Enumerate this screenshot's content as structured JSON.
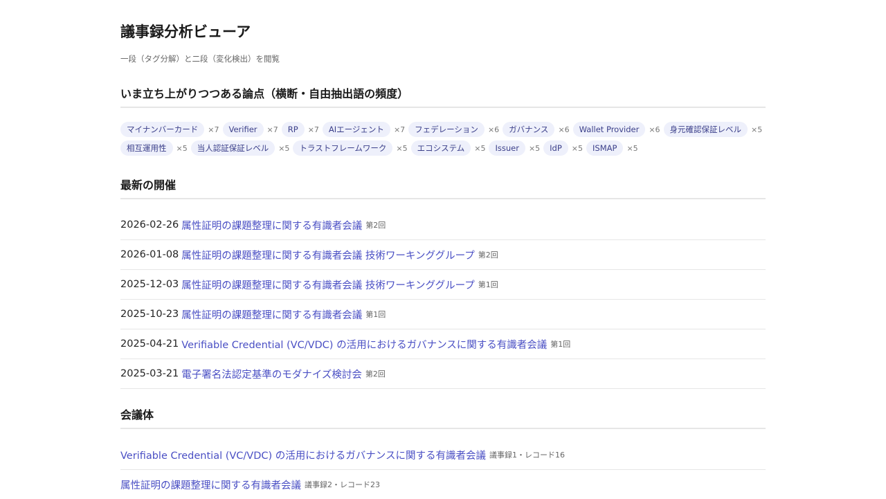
{
  "header": {
    "title": "議事録分析ビューア",
    "subtitle": "一段（タグ分解）と二段（変化検出）を閲覧"
  },
  "trending": {
    "title": "いま立ち上がりつつある論点（横断・自由抽出語の頻度）",
    "tags": [
      {
        "label": "マイナンバーカード",
        "count": "×7"
      },
      {
        "label": "Verifier",
        "count": "×7"
      },
      {
        "label": "RP",
        "count": "×7"
      },
      {
        "label": "AIエージェント",
        "count": "×7"
      },
      {
        "label": "フェデレーション",
        "count": "×6"
      },
      {
        "label": "ガバナンス",
        "count": "×6"
      },
      {
        "label": "Wallet Provider",
        "count": "×6"
      },
      {
        "label": "身元確認保証レベル",
        "count": "×5"
      },
      {
        "label": "相互運用性",
        "count": "×5"
      },
      {
        "label": "当人認証保証レベル",
        "count": "×5"
      },
      {
        "label": "トラストフレームワーク",
        "count": "×5"
      },
      {
        "label": "エコシステム",
        "count": "×5"
      },
      {
        "label": "Issuer",
        "count": "×5"
      },
      {
        "label": "IdP",
        "count": "×5"
      },
      {
        "label": "ISMAP",
        "count": "×5"
      }
    ]
  },
  "latest": {
    "title": "最新の開催",
    "meetings": [
      {
        "date": "2026-02-26",
        "name": "属性証明の課題整理に関する有識者会議",
        "round": "第2回"
      },
      {
        "date": "2026-01-08",
        "name": "属性証明の課題整理に関する有識者会議 技術ワーキンググループ",
        "round": "第2回"
      },
      {
        "date": "2025-12-03",
        "name": "属性証明の課題整理に関する有識者会議 技術ワーキンググループ",
        "round": "第1回"
      },
      {
        "date": "2025-10-23",
        "name": "属性証明の課題整理に関する有識者会議",
        "round": "第1回"
      },
      {
        "date": "2025-04-21",
        "name": "Verifiable Credential (VC/VDC) の活用におけるガバナンスに関する有識者会議",
        "round": "第1回"
      },
      {
        "date": "2025-03-21",
        "name": "電子署名法認定基準のモダナイズ検討会",
        "round": "第2回"
      }
    ]
  },
  "bodies": {
    "title": "会議体",
    "items": [
      {
        "name": "Verifiable Credential (VC/VDC) の活用におけるガバナンスに関する有識者会議",
        "stats": "議事録1・レコード16"
      },
      {
        "name": "属性証明の課題整理に関する有識者会議",
        "stats": "議事録2・レコード23"
      }
    ]
  },
  "colors": {
    "link": "#4a4fc4",
    "tag_background": "#eef0fb",
    "tag_text": "#3b3f8a",
    "divider": "#e6e6e6"
  }
}
